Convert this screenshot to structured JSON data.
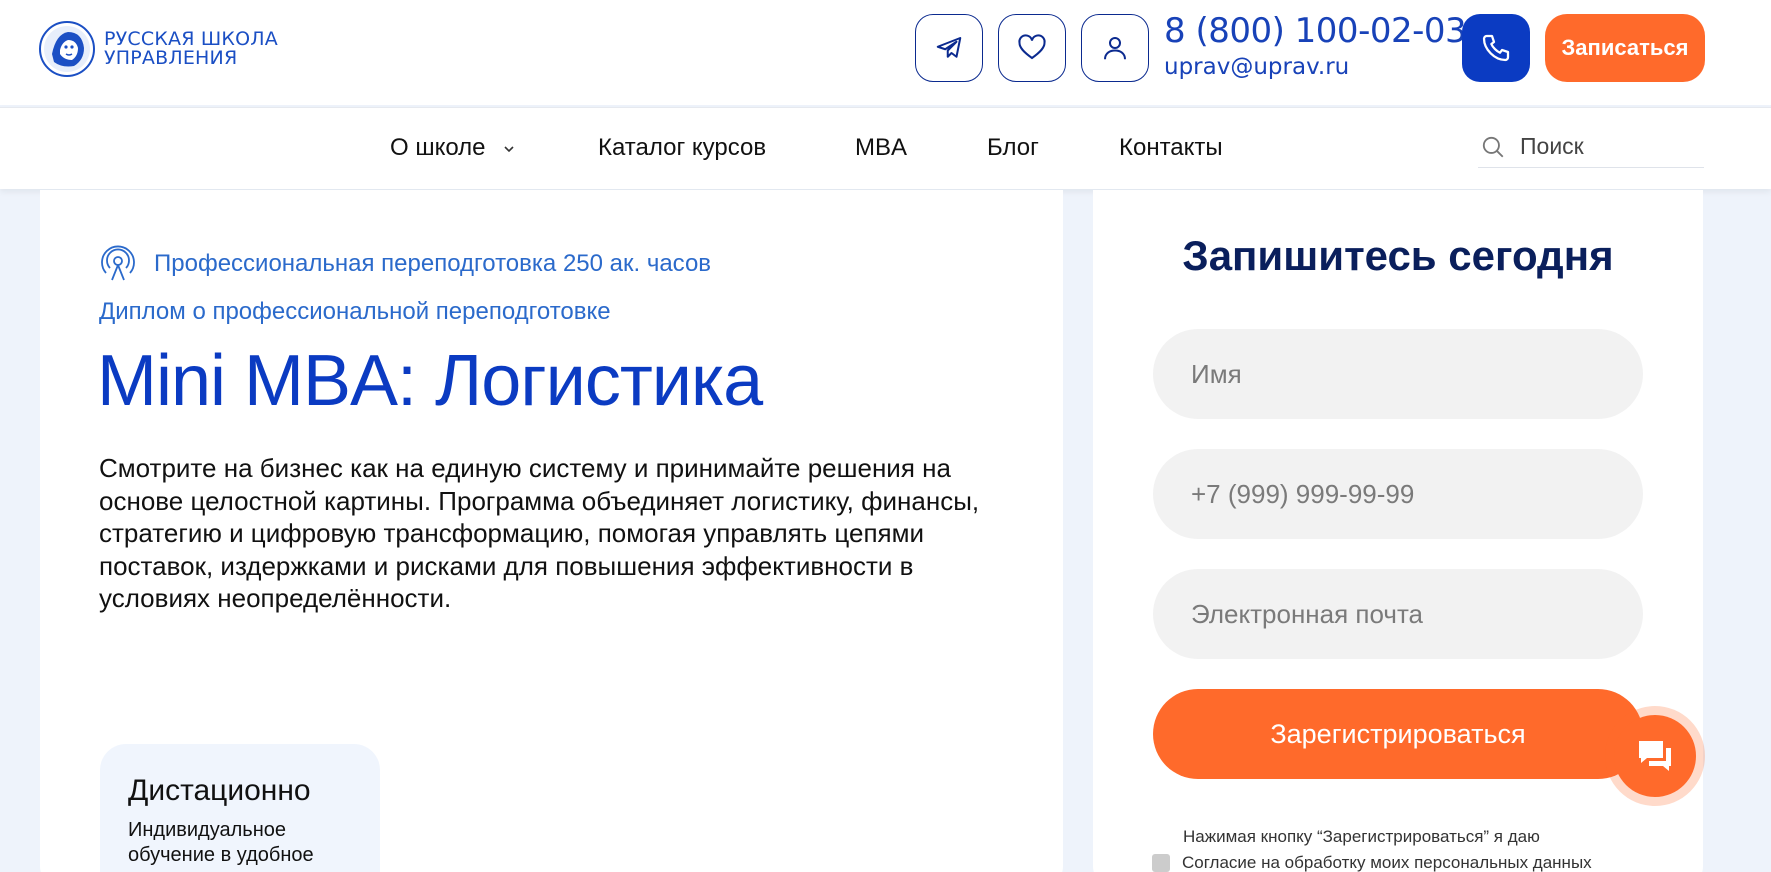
{
  "header": {
    "logo_line1": "Русская школа",
    "logo_line2": "управления",
    "phone": "8 (800) 100-02-03",
    "email": "uprav@uprav.ru",
    "signup_label": "Записаться"
  },
  "nav": {
    "items": [
      {
        "label": "О школе",
        "has_dropdown": true
      },
      {
        "label": "Каталог курсов"
      },
      {
        "label": "MBA"
      },
      {
        "label": "Блог"
      },
      {
        "label": "Контакты"
      }
    ],
    "search_placeholder": "Поиск"
  },
  "course": {
    "type": "Профессиональная переподготовка 250 ак. часов",
    "diploma": "Диплом о профессиональной переподготовке",
    "title": "Mini MBA: Логистика",
    "description": "Смотрите на бизнес как на единую систему и принимайте решения на основе целостной картины. Программа объединяет логистику, финансы, стратегию и цифровую трансформацию, помогая управлять цепями поставок, издержками и рисками для повышения эффективности в условиях неопределённости.",
    "format_title": "Дистационно",
    "format_desc": "Индивидуальное обучение в удобное"
  },
  "form": {
    "title": "Запишитесь сегодня",
    "name_placeholder": "Имя",
    "phone_placeholder": "+7 (999) 999-99-99",
    "email_placeholder": "Электронная почта",
    "register_label": "Зарегистрироваться",
    "consent_line1": "Нажимая кнопку “Зарегистрироваться” я даю",
    "consent_line2": "Согласие на обработку моих персональных данных"
  },
  "colors": {
    "brand_blue": "#0b3bc2",
    "accent_orange": "#ff6a2b",
    "dark_navy": "#0a1f5c"
  },
  "icons": [
    "telegram-icon",
    "heart-icon",
    "user-icon",
    "phone-icon",
    "search-icon",
    "chevron-down-icon",
    "broadcast-icon",
    "chat-icon"
  ]
}
